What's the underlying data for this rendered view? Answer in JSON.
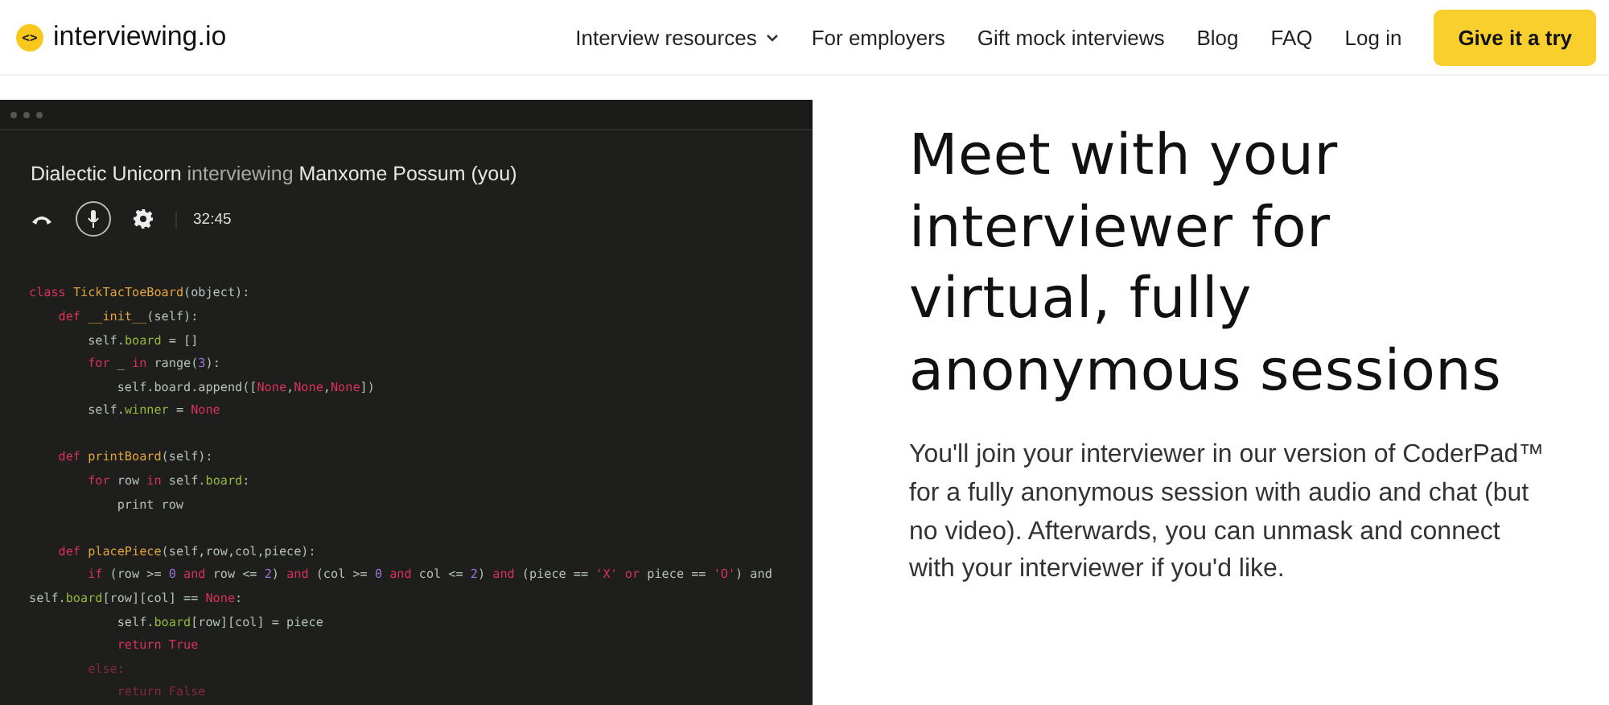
{
  "header": {
    "logo": {
      "icon": "<>",
      "text": "interviewing.io"
    },
    "nav": [
      {
        "label": "Interview resources",
        "dropdown": true
      },
      {
        "label": "For employers",
        "dropdown": false
      },
      {
        "label": "Gift mock interviews",
        "dropdown": false
      },
      {
        "label": "Blog",
        "dropdown": false
      },
      {
        "label": "FAQ",
        "dropdown": false
      },
      {
        "label": "Log in",
        "dropdown": false
      }
    ],
    "cta": "Give it a try"
  },
  "session": {
    "interviewer": "Dialectic Unicorn",
    "verb": "interviewing",
    "interviewee": "Manxome Possum (you)",
    "timer": "32:45",
    "code": [
      {
        "gap_before": false,
        "tokens": [
          {
            "text": "class ",
            "kind": "kw"
          },
          {
            "text": "TickTacToeBoard",
            "kind": "fn"
          },
          {
            "text": "(object):",
            "kind": "p"
          }
        ]
      },
      {
        "gap_before": false,
        "tokens": [
          {
            "text": "    def ",
            "kind": "kw"
          },
          {
            "text": "__init__",
            "kind": "fn"
          },
          {
            "text": "(self):",
            "kind": "p"
          }
        ]
      },
      {
        "gap_before": false,
        "tokens": [
          {
            "text": "        self.",
            "kind": "p"
          },
          {
            "text": "board",
            "kind": "a"
          },
          {
            "text": " = []",
            "kind": "p"
          }
        ]
      },
      {
        "gap_before": false,
        "tokens": [
          {
            "text": "        for",
            "kind": "kw"
          },
          {
            "text": " _ ",
            "kind": "p"
          },
          {
            "text": "in ",
            "kind": "kw"
          },
          {
            "text": "range(",
            "kind": "p"
          },
          {
            "text": "3",
            "kind": "n"
          },
          {
            "text": "):",
            "kind": "p"
          }
        ]
      },
      {
        "gap_before": false,
        "tokens": [
          {
            "text": "            self.board.append([",
            "kind": "p"
          },
          {
            "text": "None",
            "kind": "kw"
          },
          {
            "text": ",",
            "kind": "p"
          },
          {
            "text": "None",
            "kind": "kw"
          },
          {
            "text": ",",
            "kind": "p"
          },
          {
            "text": "None",
            "kind": "kw"
          },
          {
            "text": "])",
            "kind": "p"
          }
        ]
      },
      {
        "gap_before": false,
        "tokens": [
          {
            "text": "        self.",
            "kind": "p"
          },
          {
            "text": "winner",
            "kind": "a"
          },
          {
            "text": " = ",
            "kind": "p"
          },
          {
            "text": "None",
            "kind": "kw"
          }
        ]
      },
      {
        "gap_before": true,
        "tokens": [
          {
            "text": "    def ",
            "kind": "kw"
          },
          {
            "text": "printBoard",
            "kind": "fn"
          },
          {
            "text": "(self):",
            "kind": "p"
          }
        ]
      },
      {
        "gap_before": false,
        "tokens": [
          {
            "text": "        for",
            "kind": "kw"
          },
          {
            "text": " row ",
            "kind": "p"
          },
          {
            "text": "in",
            "kind": "kw"
          },
          {
            "text": " self.",
            "kind": "p"
          },
          {
            "text": "board",
            "kind": "a"
          },
          {
            "text": ":",
            "kind": "p"
          }
        ]
      },
      {
        "gap_before": false,
        "tokens": [
          {
            "text": "            print row",
            "kind": "p"
          }
        ]
      },
      {
        "gap_before": true,
        "tokens": [
          {
            "text": "    def ",
            "kind": "kw"
          },
          {
            "text": "placePiece",
            "kind": "fn"
          },
          {
            "text": "(self,row,col,piece):",
            "kind": "p"
          }
        ]
      },
      {
        "gap_before": false,
        "tokens": [
          {
            "text": "        if",
            "kind": "kw"
          },
          {
            "text": " (row >= ",
            "kind": "p"
          },
          {
            "text": "0",
            "kind": "n"
          },
          {
            "text": " and ",
            "kind": "kw"
          },
          {
            "text": "row <= ",
            "kind": "p"
          },
          {
            "text": "2",
            "kind": "n"
          },
          {
            "text": ") ",
            "kind": "p"
          },
          {
            "text": "and",
            "kind": "kw"
          },
          {
            "text": " (col >= ",
            "kind": "p"
          },
          {
            "text": "0",
            "kind": "n"
          },
          {
            "text": " and ",
            "kind": "kw"
          },
          {
            "text": "col <= ",
            "kind": "p"
          },
          {
            "text": "2",
            "kind": "n"
          },
          {
            "text": ") ",
            "kind": "p"
          },
          {
            "text": "and",
            "kind": "kw"
          },
          {
            "text": " (piece == ",
            "kind": "p"
          },
          {
            "text": "'X'",
            "kind": "s"
          },
          {
            "text": " or ",
            "kind": "kw"
          },
          {
            "text": "piece == ",
            "kind": "p"
          },
          {
            "text": "'O'",
            "kind": "s"
          },
          {
            "text": ") and",
            "kind": "p"
          }
        ]
      },
      {
        "gap_before": false,
        "tokens": [
          {
            "text": "self.",
            "kind": "p"
          },
          {
            "text": "board",
            "kind": "a"
          },
          {
            "text": "[row][col] == ",
            "kind": "p"
          },
          {
            "text": "None",
            "kind": "kw"
          },
          {
            "text": ":",
            "kind": "p"
          }
        ]
      },
      {
        "gap_before": false,
        "tokens": [
          {
            "text": "            self.",
            "kind": "p"
          },
          {
            "text": "board",
            "kind": "a"
          },
          {
            "text": "[row][col] = piece",
            "kind": "p"
          }
        ]
      },
      {
        "gap_before": false,
        "tokens": [
          {
            "text": "            return ",
            "kind": "kw"
          },
          {
            "text": "True",
            "kind": "kw"
          }
        ]
      },
      {
        "gap_before": false,
        "tokens": [
          {
            "text": "        else:",
            "kind": "kw"
          }
        ]
      },
      {
        "gap_before": false,
        "tokens": [
          {
            "text": "            return False",
            "kind": "kw"
          }
        ]
      }
    ]
  },
  "hero": {
    "heading_lines": [
      "Meet with your",
      "interviewer for",
      "virtual, fully",
      "anonymous sessions"
    ],
    "body": "You'll join your interviewer in our version of CoderPad™ for a fully anonymous session with audio and chat (but no video). Afterwards, you can unmask and connect with your interviewer if you'd like."
  }
}
